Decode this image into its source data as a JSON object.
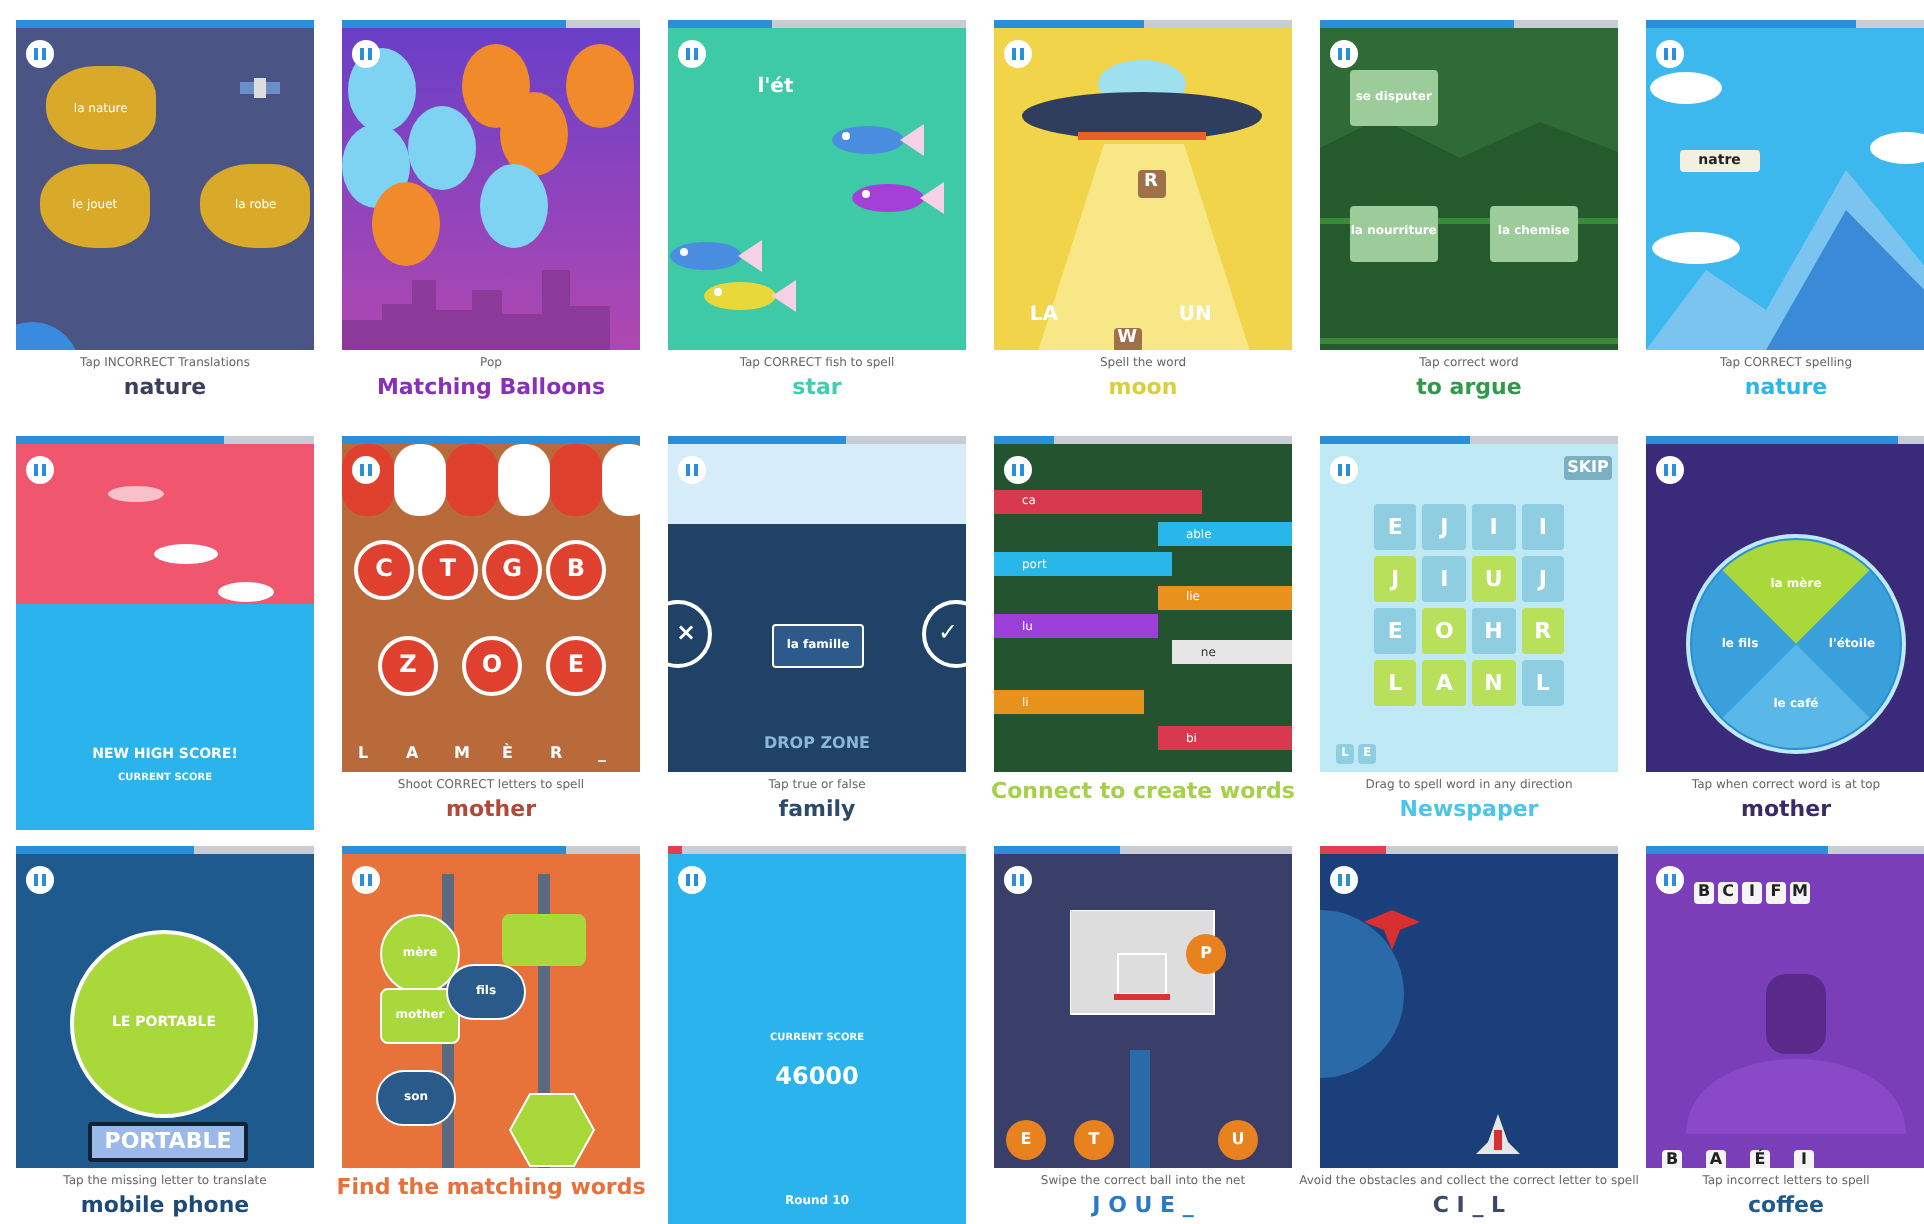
{
  "tiles": [
    {
      "kind": "asteroids",
      "level": 1,
      "rocks": [
        "la nature",
        "le jouet",
        "la robe"
      ],
      "instruction": "Tap INCORRECT Translations",
      "word": "nature"
    },
    {
      "kind": "balloons",
      "level": 0.75,
      "balloons": [
        {
          "color": "#7fd3f2"
        },
        {
          "color": "#f08a2a"
        },
        {
          "color": "#f08a2a"
        },
        {
          "color": "#f08a2a"
        },
        {
          "color": "#7fd3f2"
        },
        {
          "color": "#7fd3f2"
        },
        {
          "color": "#f08a2a"
        },
        {
          "color": "#7fd3f2"
        }
      ],
      "instruction": "Pop",
      "word": "Matching Balloons"
    },
    {
      "kind": "fish",
      "level": 0.35,
      "spelled": "l'ét",
      "instruction": "Tap CORRECT fish to spell",
      "word": "star"
    },
    {
      "kind": "ufo",
      "level": 0.5,
      "falling": "R",
      "dropped": "W",
      "left": "LA",
      "right": "UN",
      "instruction": "Spell the word",
      "word": "moon"
    },
    {
      "kind": "cards",
      "level": 0.65,
      "cards": [
        "se disputer",
        "la nourriture",
        "la chemise"
      ],
      "instruction": "Tap correct word",
      "word": "to argue"
    },
    {
      "kind": "sky",
      "level": 0.75,
      "banner": "natre",
      "instruction": "Tap CORRECT spelling",
      "word": "nature"
    },
    {
      "kind": "highscore",
      "level": 0.7,
      "headline": "NEW HIGH SCORE!",
      "subline": "CURRENT SCORE"
    },
    {
      "kind": "letters",
      "level": 1,
      "letters": [
        "C",
        "T",
        "G",
        "B",
        "Z",
        "O",
        "E"
      ],
      "spelled": [
        "L",
        "A",
        "M",
        "È",
        "R",
        "_"
      ],
      "instruction": "Shoot CORRECT letters to spell",
      "word": "mother"
    },
    {
      "kind": "truefalse",
      "level": 0.6,
      "false_mark": "×",
      "true_mark": "✓",
      "card": "la famille",
      "zone": "DROP ZONE",
      "instruction": "Tap true or false",
      "word": "family"
    },
    {
      "kind": "pipes",
      "level": 0.2,
      "pipes": [
        {
          "label": "ca",
          "color": "#d9394e"
        },
        {
          "label": "able",
          "color": "#29b6e8"
        },
        {
          "label": "port",
          "color": "#29b6e8"
        },
        {
          "label": "lie",
          "color": "#e8921e"
        },
        {
          "label": "lu",
          "color": "#9b3fd8"
        },
        {
          "label": "ne",
          "color": "#e6e6e6"
        },
        {
          "label": "li",
          "color": "#e8921e"
        },
        {
          "label": "bi",
          "color": "#d9394e"
        }
      ],
      "word": "Connect to create words"
    },
    {
      "kind": "wordsearch",
      "level": 0.5,
      "skip": "SKIP",
      "grid": [
        {
          "letter": "E",
          "selected": false
        },
        {
          "letter": "J",
          "selected": false
        },
        {
          "letter": "I",
          "selected": false
        },
        {
          "letter": "I",
          "selected": false
        },
        {
          "letter": "J",
          "selected": true
        },
        {
          "letter": "I",
          "selected": false
        },
        {
          "letter": "U",
          "selected": true
        },
        {
          "letter": "J",
          "selected": false
        },
        {
          "letter": "E",
          "selected": false
        },
        {
          "letter": "O",
          "selected": true
        },
        {
          "letter": "H",
          "selected": false
        },
        {
          "letter": "R",
          "selected": true
        },
        {
          "letter": "L",
          "selected": true
        },
        {
          "letter": "A",
          "selected": true
        },
        {
          "letter": "N",
          "selected": true
        },
        {
          "letter": "L",
          "selected": false
        }
      ],
      "tray": [
        "L",
        "E"
      ],
      "instruction": "Drag to spell word in any direction",
      "word": "Newspaper"
    },
    {
      "kind": "wheel",
      "level": 0.9,
      "segments": [
        {
          "label": "la mère",
          "selected": true
        },
        {
          "label": "l'étoile",
          "selected": false
        },
        {
          "label": "le café",
          "selected": false
        },
        {
          "label": "le fils",
          "selected": false
        }
      ],
      "instruction": "Tap when correct word is at top",
      "word": "mother"
    },
    {
      "kind": "portable",
      "level": 0.6,
      "circle": "LE PORTABLE",
      "answer": "PORTABLE",
      "instruction": "Tap the missing letter to translate",
      "word": "mobile phone"
    },
    {
      "kind": "signs",
      "level": 0.75,
      "signs": [
        {
          "label": "mère",
          "kind": "circle"
        },
        {
          "label": "mother",
          "kind": "rect"
        },
        {
          "label": "fils",
          "kind": "pill"
        },
        {
          "label": "son",
          "kind": "pill"
        }
      ],
      "word": "Find the matching words"
    },
    {
      "kind": "finalscore",
      "level": 0.05,
      "caption": "CURRENT SCORE",
      "score": "46000",
      "round": "Round 10"
    },
    {
      "kind": "basketball",
      "level": 0.42,
      "balls": [
        "P",
        "E",
        "T",
        "U"
      ],
      "instruction": "Swipe the correct ball into the net",
      "word": "J O U E _"
    },
    {
      "kind": "shooter",
      "level": 0.22,
      "instruction": "Avoid the obstacles and collect the correct letter to spell",
      "word": "C I _ L"
    },
    {
      "kind": "purpletiles",
      "level": 0.65,
      "top": [
        "B",
        "C",
        "I",
        "F",
        "M"
      ],
      "bottom": [
        "B",
        "A",
        "É",
        "I"
      ],
      "instruction": "Tap incorrect letters to spell",
      "word": "coffee"
    }
  ]
}
